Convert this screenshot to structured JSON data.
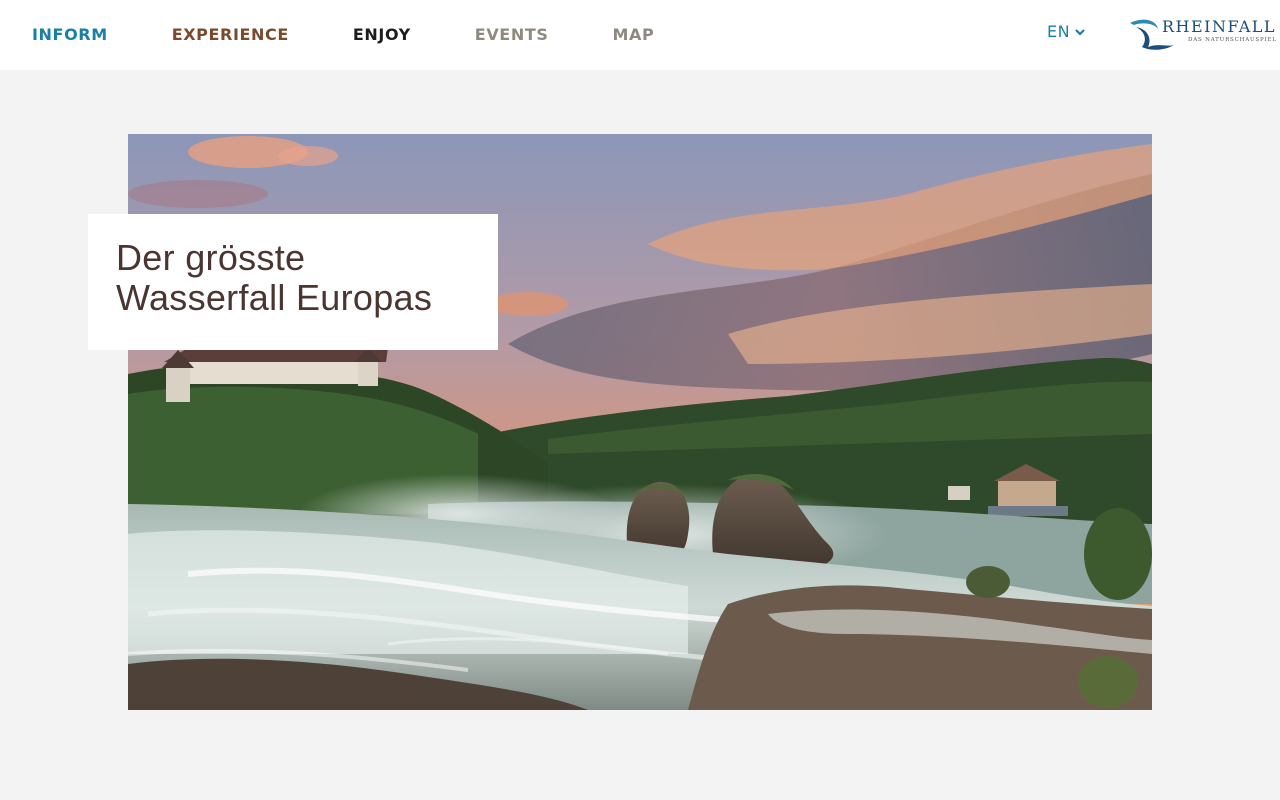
{
  "header": {
    "nav": [
      {
        "label": "INFORM",
        "color": "#1a7fa6"
      },
      {
        "label": "EXPERIENCE",
        "color": "#7a4a2c"
      },
      {
        "label": "ENJOY",
        "color": "#1d1d1d"
      },
      {
        "label": "EVENTS",
        "color": "#8e8a7f"
      },
      {
        "label": "MAP",
        "color": "#8e8a7f"
      }
    ],
    "language": {
      "selected": "EN",
      "icon": "chevron-down-icon",
      "color": "#1a7fa6"
    },
    "logo": {
      "wordmark": "RHEINFALL",
      "tagline": "DAS NATURSCHAUSPIEL",
      "color": "#1b4f7a"
    }
  },
  "hero": {
    "image_alt": "Rheinfall waterfall at sunset with Laufen castle and rocks",
    "headline_line1": "Der grösste",
    "headline_line2": "Wasserfall Europas"
  },
  "colors": {
    "background": "#f3f3f3",
    "headline": "#4a3530"
  }
}
